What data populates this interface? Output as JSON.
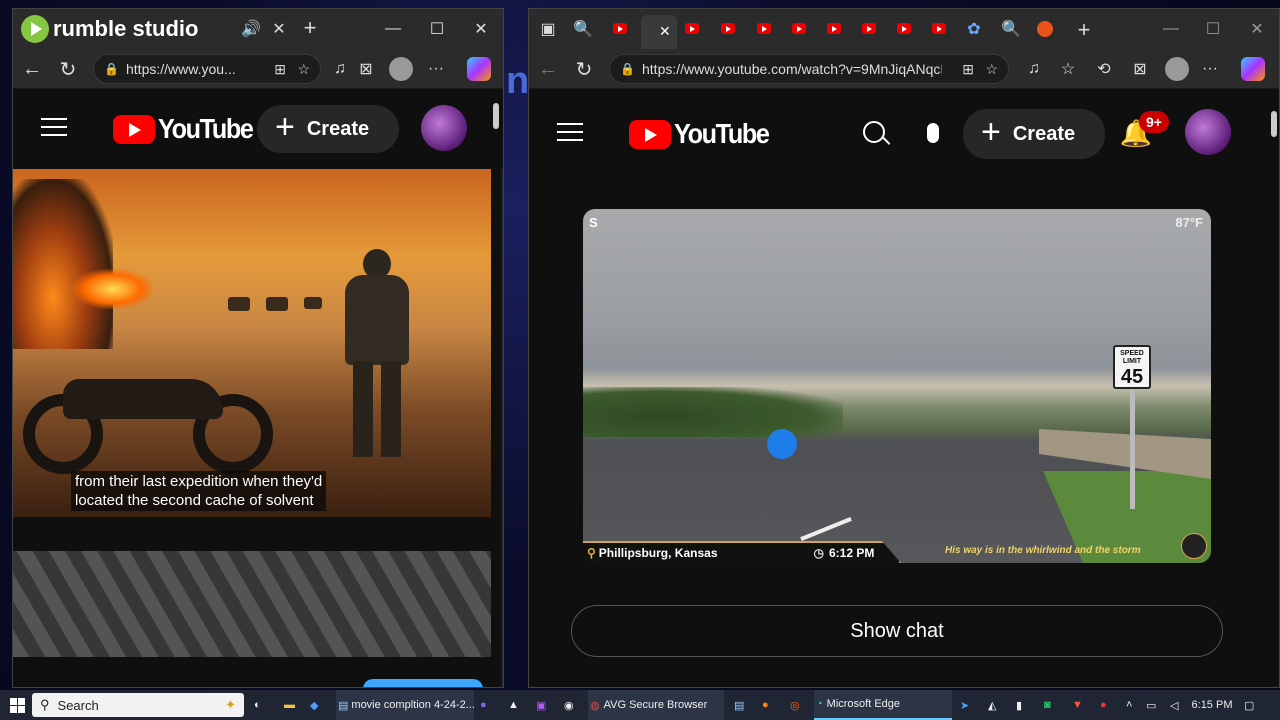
{
  "left_window": {
    "app_badge": "rumble studio",
    "url": "https://www.you...",
    "yt_logo_text": "YouTube",
    "create_label": "Create",
    "caption_line1": "from their last expedition when they'd",
    "caption_line2": "located the second cache of solvent"
  },
  "right_window": {
    "url": "https://www.youtube.com/watch?v=9MnJiqANqcI",
    "yt_logo_text": "YouTube",
    "create_label": "Create",
    "notif_badge": "9+",
    "video": {
      "top_left": "S",
      "temperature": "87°F",
      "speed_sign_top": "SPEED",
      "speed_sign_mid": "LIMIT",
      "speed_sign_value": "45",
      "location": "Phillipsburg, Kansas",
      "time": "6:12 PM",
      "tagline": "His way is in the whirlwind and the storm"
    },
    "show_chat_label": "Show chat"
  },
  "taskbar": {
    "search_placeholder": "Search",
    "item1": "movie compltion 4-24-2...",
    "item2": "AVG Secure Browser",
    "item3": "Microsoft Edge",
    "clock": "6:15 PM"
  },
  "colors": {
    "yt_red": "#ff0000",
    "rumble_green": "#85c742",
    "notif_red": "#cc0000"
  }
}
